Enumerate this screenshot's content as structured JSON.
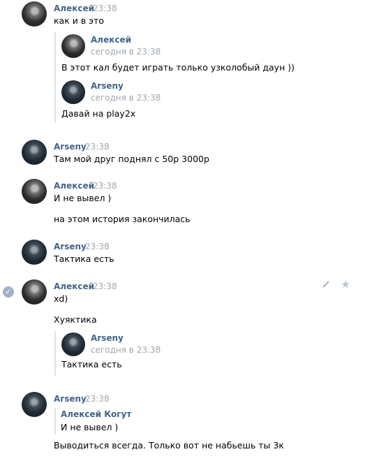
{
  "messages": [
    {
      "author": "Алексей",
      "time": "23:38",
      "texts": [
        "как и в это"
      ],
      "forwarded": [
        {
          "author": "Алексей",
          "time": "сегодня в 23:38",
          "text": "В этот кал будет играть только узколобый даун ))"
        },
        {
          "author": "Arseny",
          "time": "сегодня в 23:38",
          "text": "Давай на play2x"
        }
      ]
    },
    {
      "author": "Arseny",
      "time": "23:38",
      "texts": [
        "Там мой друг поднял с 50р 3000р"
      ]
    },
    {
      "author": "Алексей",
      "time": "23:38",
      "texts": [
        "И не вывел )",
        "на этом история закончилась"
      ]
    },
    {
      "author": "Arseny",
      "time": "23:38",
      "texts": [
        "Тактика есть"
      ]
    },
    {
      "author": "Алексей",
      "time": "23:38",
      "texts": [
        "xd)",
        "Хуяктика"
      ],
      "forwarded": [
        {
          "author": "Arseny",
          "time": "сегодня в 23:38",
          "text": "Тактика есть"
        }
      ]
    },
    {
      "author": "Arseny",
      "time": "23:38",
      "reply": {
        "author": "Алексей Когут",
        "text": "И не вывел )"
      },
      "texts": [
        "Выводиться всегда. Только вот не набьешь ты 3к"
      ]
    }
  ],
  "icons": {
    "selected": "check-circle-icon",
    "edit": "pencil-icon",
    "favorite": "star-icon"
  },
  "colors": {
    "author": "#42648b",
    "time": "#a0a7ae",
    "quote_bar": "#dbe3ec",
    "selected": "#9fb2c6"
  }
}
